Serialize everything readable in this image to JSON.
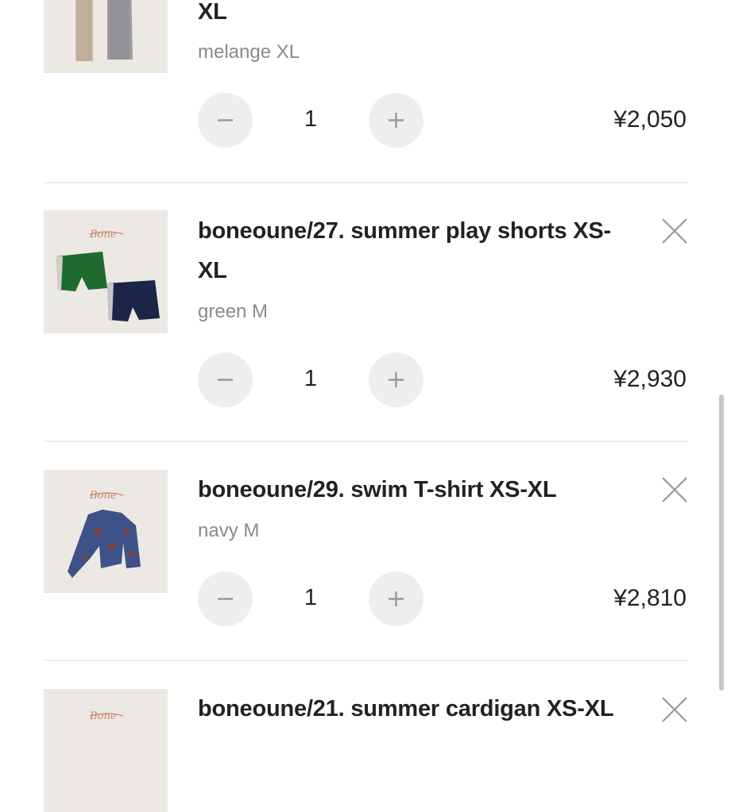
{
  "cart": {
    "items": [
      {
        "title_line2": "XL",
        "variant": "melange XL",
        "quantity": "1",
        "price": "¥2,050",
        "decrease_icon": "minus-icon",
        "increase_icon": "plus-icon"
      },
      {
        "title_line1": "boneoune/27. summer play shorts XS-",
        "title_line2": "XL",
        "variant": "green M",
        "quantity": "1",
        "price": "¥2,930",
        "remove_icon": "close-icon"
      },
      {
        "title_line1": "boneoune/29. swim T-shirt XS-XL",
        "variant": "navy M",
        "quantity": "1",
        "price": "¥2,810",
        "remove_icon": "close-icon"
      },
      {
        "title_line1": "boneoune/21. summer cardigan XS-XL",
        "remove_icon": "close-icon"
      }
    ]
  },
  "colors": {
    "button_bg": "#eeeeee",
    "icon": "#999999",
    "variant_text": "#8a8a8a",
    "divider": "#ececec"
  }
}
